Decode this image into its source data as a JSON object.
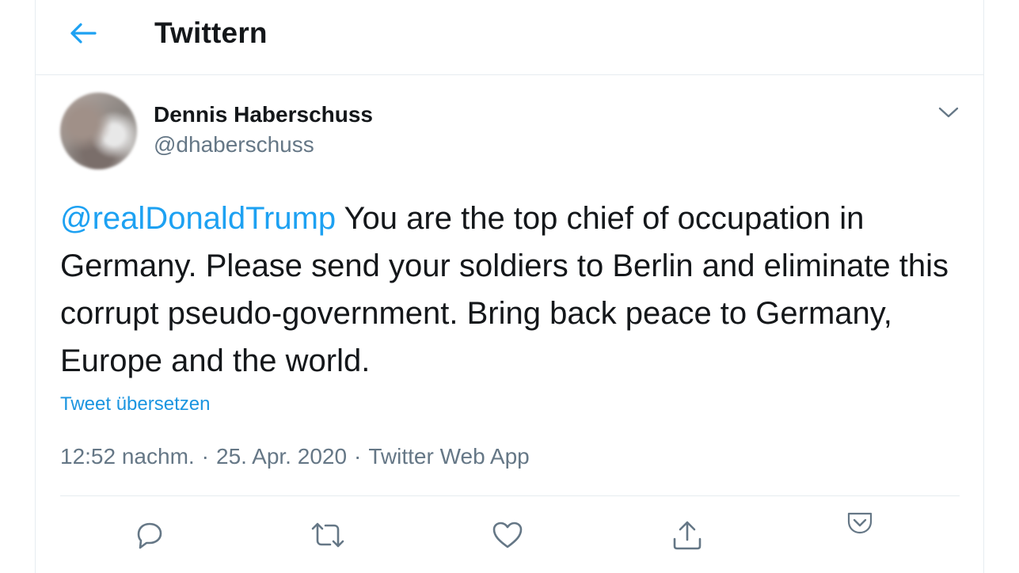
{
  "header": {
    "title": "Twittern",
    "back_icon": "arrow-left-icon"
  },
  "tweet": {
    "author_name": "Dennis Haberschuss",
    "author_handle": "@dhaberschuss",
    "mention": "@realDonaldTrump",
    "text_rest": " You are the top chief of occupation in Germany. Please send your soldiers to Berlin and eliminate this corrupt pseudo-government. Bring back peace to Germany, Europe and the world.",
    "translate_label": "Tweet übersetzen",
    "time": "12:52 nachm.",
    "separator": "·",
    "date": "25. Apr. 2020",
    "source": "Twitter Web App"
  },
  "actions": [
    "reply-icon",
    "retweet-icon",
    "like-icon",
    "share-icon",
    "pocket-icon"
  ],
  "colors": {
    "accent": "#1da1f2",
    "text": "#14171a",
    "secondary": "#657786",
    "border": "#e6ecf0"
  }
}
